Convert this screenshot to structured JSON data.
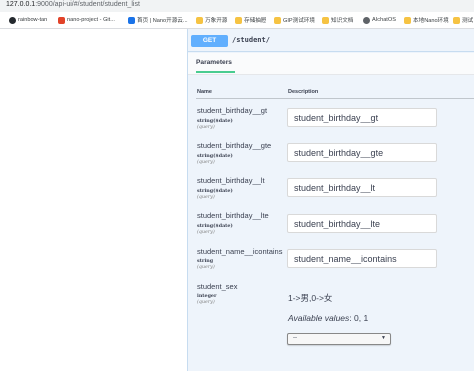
{
  "browser": {
    "url_host": "127.0.0.1",
    "url_rest": ":9000/api-ui/#/student/student_list"
  },
  "bookmarks": [
    {
      "label": "rainbow-tan",
      "icon": "github-icon",
      "color": "#24292e"
    },
    {
      "label": "nano-project - Git...",
      "icon": "gitlab-icon",
      "color": "#e24329"
    },
    {
      "label": "首页 | Nano开源云...",
      "icon": "nano-icon",
      "color": "#1a73e8"
    },
    {
      "label": "万象开源",
      "icon": "folder-icon",
      "color": "#f6c343"
    },
    {
      "label": "存储抽屉",
      "icon": "folder-icon",
      "color": "#f6c343"
    },
    {
      "label": "GIP测试环境",
      "icon": "folder-icon",
      "color": "#f6c343"
    },
    {
      "label": "知识文档",
      "icon": "folder-icon",
      "color": "#f6c343"
    },
    {
      "label": "AIchatOS",
      "icon": "globe-icon",
      "color": "#5f6368"
    },
    {
      "label": "本地Nano环境",
      "icon": "folder-icon",
      "color": "#f6c343"
    },
    {
      "label": "测试",
      "icon": "folder-icon",
      "color": "#f6c343"
    }
  ],
  "operation": {
    "method": "GET",
    "path": "/student/",
    "method_color": "#61affe"
  },
  "tabs": {
    "parameters": "Parameters"
  },
  "columns": {
    "name": "Name",
    "description": "Description"
  },
  "params": [
    {
      "name": "student_birthday__gt",
      "type": "string($date)",
      "in": "(query)",
      "placeholder": "student_birthday__gt"
    },
    {
      "name": "student_birthday__gte",
      "type": "string($date)",
      "in": "(query)",
      "placeholder": "student_birthday__gte"
    },
    {
      "name": "student_birthday__lt",
      "type": "string($date)",
      "in": "(query)",
      "placeholder": "student_birthday__lt"
    },
    {
      "name": "student_birthday__lte",
      "type": "string($date)",
      "in": "(query)",
      "placeholder": "student_birthday__lte"
    },
    {
      "name": "student_name__icontains",
      "type": "string",
      "in": "(query)",
      "placeholder": "student_name__icontains"
    }
  ],
  "sex_param": {
    "name": "student_sex",
    "type": "integer",
    "in": "(query)",
    "description": "1->男,0->女",
    "available_label": "Available values",
    "available_values": ": 0, 1",
    "selected": "--"
  }
}
